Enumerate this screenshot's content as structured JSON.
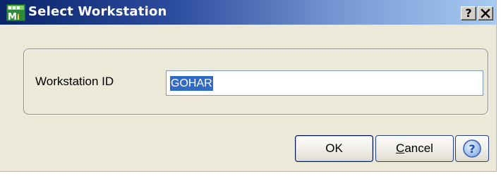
{
  "window": {
    "title": "Select Workstation",
    "app_icon": "mas90-app-icon",
    "help_label": "?",
    "close_label": "✕"
  },
  "form": {
    "workstation_label": "Workstation ID",
    "workstation_value": "GOHAR"
  },
  "buttons": {
    "ok_label": "OK",
    "cancel_label": "Cancel",
    "cancel_mnemonic": "C",
    "cancel_rest": "ancel",
    "help_icon": "help-circle-icon"
  },
  "colors": {
    "titlebar_start": "#0a246a",
    "titlebar_end": "#a6caf0",
    "dialog_bg": "#ece9d8",
    "selection": "#316ac5",
    "button_border": "#24408c"
  }
}
